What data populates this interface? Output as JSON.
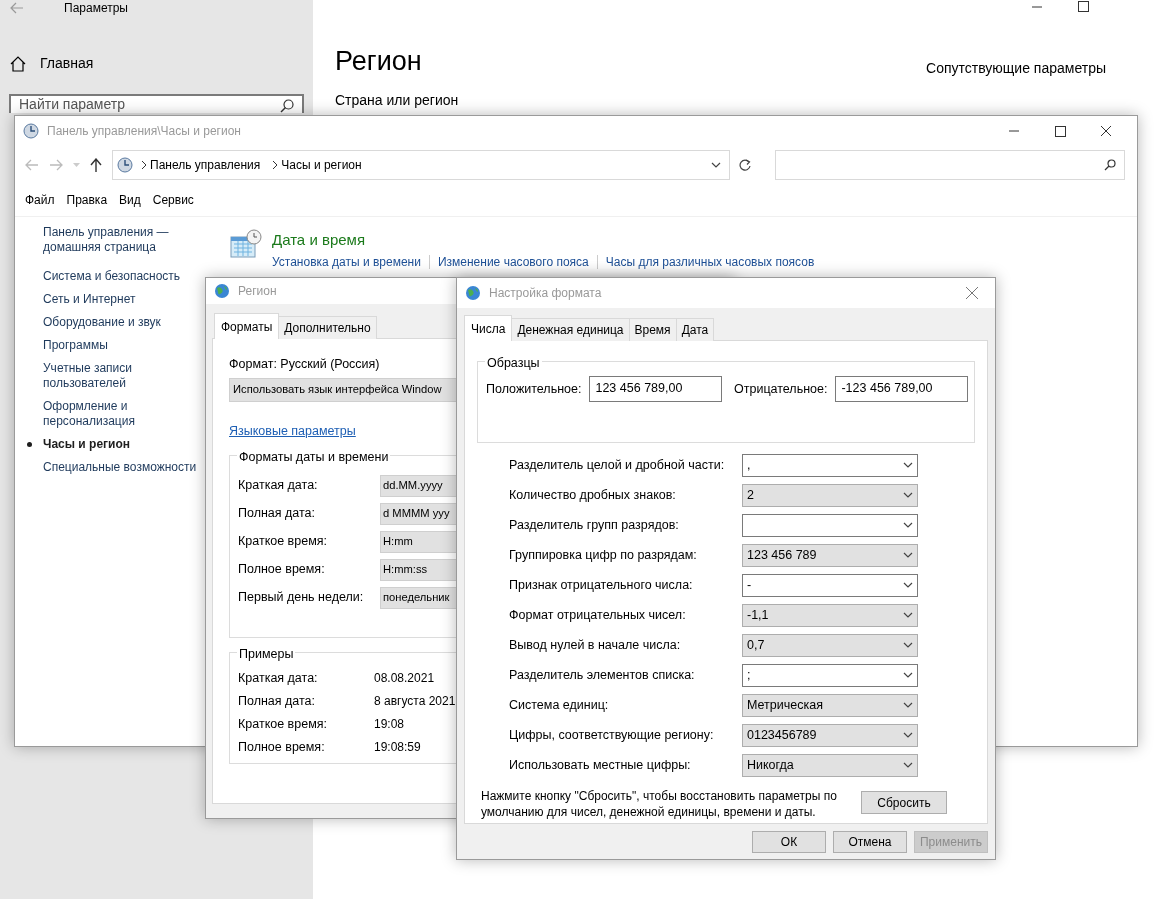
{
  "settings_window": {
    "title": "Параметры",
    "home": "Главная",
    "search": {
      "placeholder": "Найти параметр"
    },
    "heading": "Регион",
    "section": "Страна или регион",
    "related": "Сопутствующие параметры"
  },
  "control_panel": {
    "title": "Панель управления\\Часы и регион",
    "breadcrumb": [
      "Панель управления",
      "Часы и регион"
    ],
    "menu": [
      "Файл",
      "Правка",
      "Вид",
      "Сервис"
    ],
    "sidebar": [
      {
        "label": "Панель управления — домашняя страница",
        "selected": false
      },
      {
        "label": "Система и безопасность",
        "selected": false
      },
      {
        "label": "Сеть и Интернет",
        "selected": false
      },
      {
        "label": "Оборудование и звук",
        "selected": false
      },
      {
        "label": "Программы",
        "selected": false
      },
      {
        "label": "Учетные записи пользователей",
        "selected": false
      },
      {
        "label": "Оформление и персонализация",
        "selected": false
      },
      {
        "label": "Часы и регион",
        "selected": true
      },
      {
        "label": "Специальные возможности",
        "selected": false
      }
    ],
    "category": {
      "title": "Дата и время",
      "links": [
        "Установка даты и времени",
        "Изменение часового пояса",
        "Часы для различных часовых поясов"
      ]
    }
  },
  "region_dialog": {
    "title": "Регион",
    "tabs": [
      {
        "label": "Форматы",
        "selected": true
      },
      {
        "label": "Дополнительно",
        "selected": false
      }
    ],
    "format_label": "Формат: Русский (Россия)",
    "format_value": "Использовать язык интерфейса Window",
    "link": "Языковые параметры",
    "formats_group": {
      "title": "Форматы даты и времени",
      "rows": [
        {
          "label": "Краткая дата:",
          "value": "dd.MM.yyyy"
        },
        {
          "label": "Полная дата:",
          "value": "d MMMM yyy"
        },
        {
          "label": "Краткое время:",
          "value": "H:mm"
        },
        {
          "label": "Полное время:",
          "value": "H:mm:ss"
        },
        {
          "label": "Первый день недели:",
          "value": "понедельник"
        }
      ]
    },
    "examples_group": {
      "title": "Примеры",
      "rows": [
        {
          "label": "Краткая дата:",
          "value": "08.08.2021"
        },
        {
          "label": "Полная дата:",
          "value": "8 августа 2021"
        },
        {
          "label": "Краткое время:",
          "value": "19:08"
        },
        {
          "label": "Полное время:",
          "value": "19:08:59"
        }
      ]
    }
  },
  "format_dialog": {
    "title": "Настройка формата",
    "tabs": [
      {
        "label": "Числа",
        "selected": true
      },
      {
        "label": "Денежная единица",
        "selected": false
      },
      {
        "label": "Время",
        "selected": false
      },
      {
        "label": "Дата",
        "selected": false
      }
    ],
    "samples": {
      "title": "Образцы",
      "positive_label": "Положительное:",
      "positive": "123 456 789,00",
      "negative_label": "Отрицательное:",
      "negative": "-123 456 789,00"
    },
    "settings": [
      {
        "label": "Разделитель целой и дробной части:",
        "value": ",",
        "kind": "edit"
      },
      {
        "label": "Количество дробных знаков:",
        "value": "2",
        "kind": "list"
      },
      {
        "label": "Разделитель групп разрядов:",
        "kind": "edit"
      },
      {
        "label": "Группировка цифр по разрядам:",
        "value": "123 456 789",
        "kind": "list"
      },
      {
        "label": "Признак отрицательного числа:",
        "value": "-",
        "kind": "edit"
      },
      {
        "label": "Формат отрицательных чисел:",
        "value": "-1,1",
        "kind": "list"
      },
      {
        "label": "Вывод нулей в начале числа:",
        "value": "0,7",
        "kind": "list"
      },
      {
        "label": "Разделитель элементов списка:",
        "value": ";",
        "kind": "edit"
      },
      {
        "label": "Система единиц:",
        "value": "Метрическая",
        "kind": "list"
      },
      {
        "label": "Цифры, соответствующие региону:",
        "value": "0123456789",
        "kind": "list"
      },
      {
        "label": "Использовать местные цифры:",
        "value": "Никогда",
        "kind": "list"
      }
    ],
    "reset_note": "Нажмите кнопку \"Сбросить\", чтобы восстановить параметры по умолчанию для чисел, денежной единицы, времени и даты.",
    "reset_button": "Сбросить",
    "buttons": [
      {
        "label": "ОК",
        "disabled": false
      },
      {
        "label": "Отмена",
        "disabled": false
      },
      {
        "label": "Применить",
        "disabled": true
      }
    ]
  }
}
